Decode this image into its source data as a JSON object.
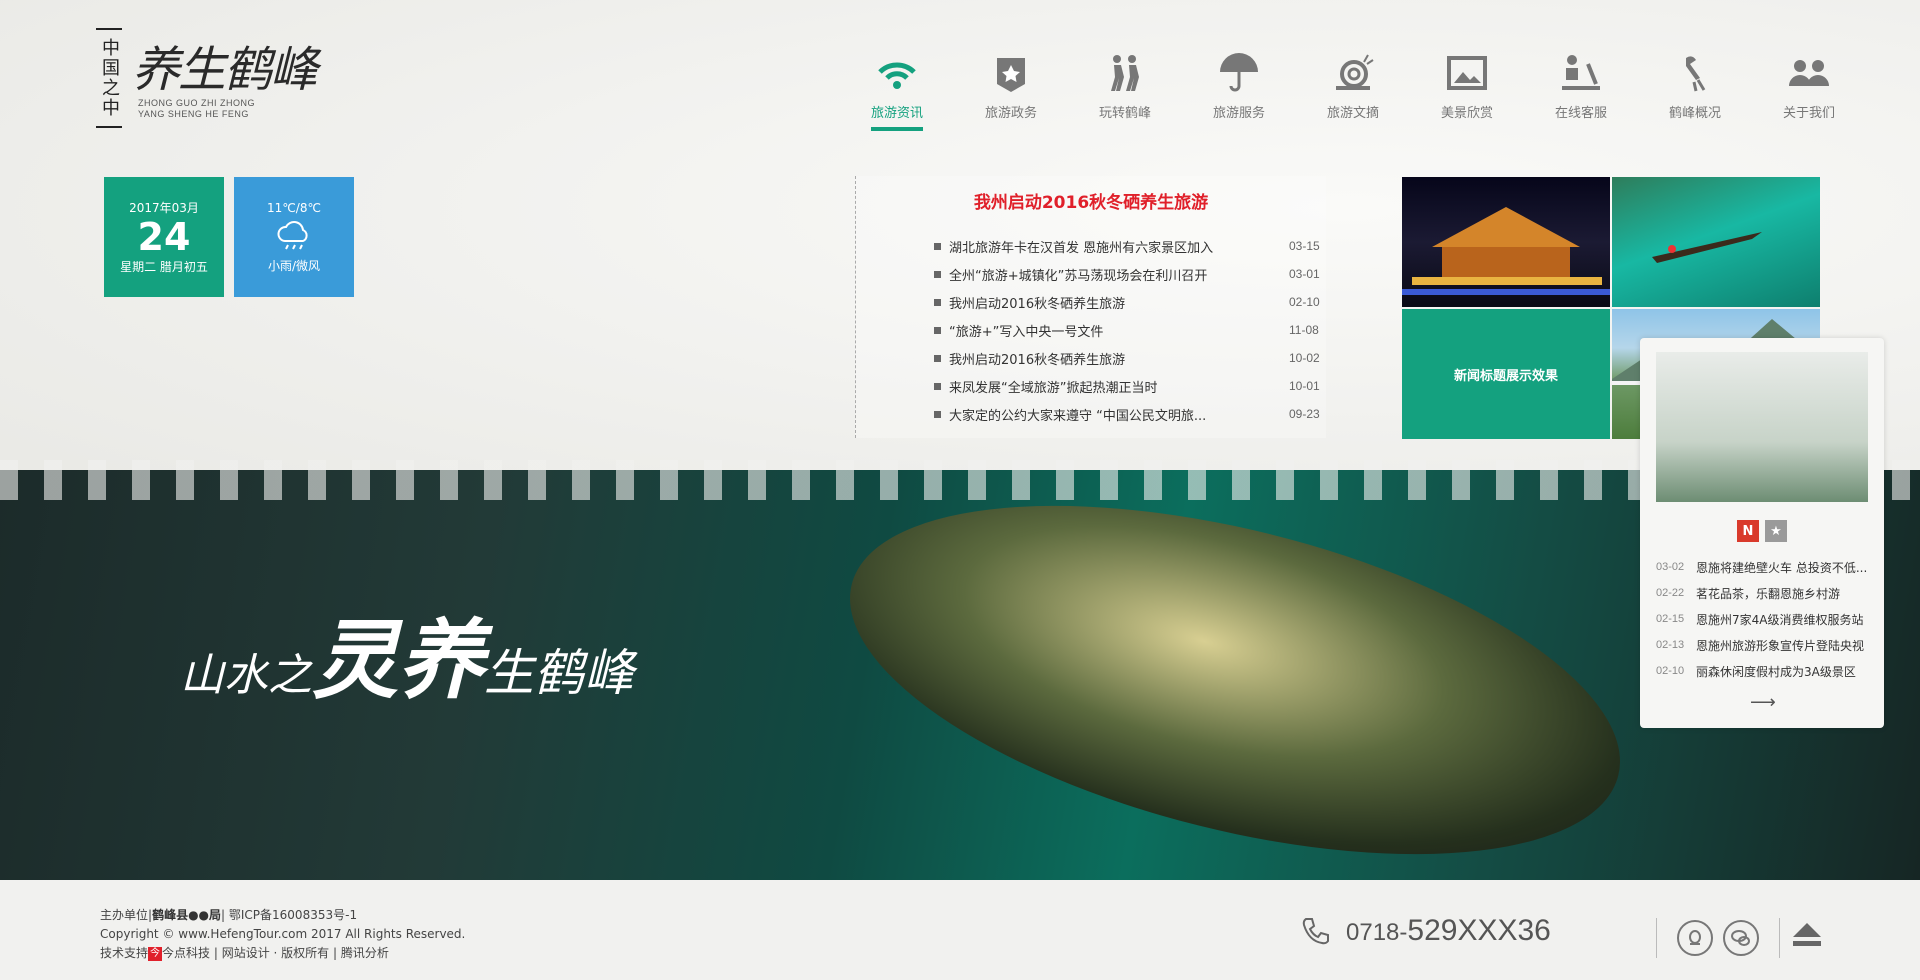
{
  "logo": {
    "vertical_text": "中国之中",
    "brush_text": "养生鹤峰",
    "pinyin_line1": "ZHONG GUO ZHI ZHONG",
    "pinyin_line2": "YANG SHENG HE FENG"
  },
  "nav": {
    "items": [
      {
        "label": "旅游资讯",
        "icon": "wifi-icon",
        "active": true
      },
      {
        "label": "旅游政务",
        "icon": "star-badge-icon"
      },
      {
        "label": "玩转鹤峰",
        "icon": "people-walking-icon"
      },
      {
        "label": "旅游服务",
        "icon": "umbrella-icon"
      },
      {
        "label": "旅游文摘",
        "icon": "snail-icon"
      },
      {
        "label": "美景欣赏",
        "icon": "picture-frame-icon"
      },
      {
        "label": "在线客服",
        "icon": "person-desk-icon"
      },
      {
        "label": "鹤峰概况",
        "icon": "crane-icon"
      },
      {
        "label": "关于我们",
        "icon": "group-icon"
      }
    ]
  },
  "date": {
    "year_month": "2017年03月",
    "day": "24",
    "weekday_lunar": "星期二 腊月初五"
  },
  "weather": {
    "temperature": "11℃/8℃",
    "condition": "小雨/微风",
    "icon": "cloud-rain-icon"
  },
  "news": {
    "headline": "我州启动2016秋冬硒养生旅游",
    "items": [
      {
        "title": "湖北旅游年卡在汉首发 恩施州有六家景区加入",
        "date": "03-15"
      },
      {
        "title": "全州“旅游+城镇化”苏马荡现场会在利川召开",
        "date": "03-01"
      },
      {
        "title": "我州启动2016秋冬硒养生旅游",
        "date": "02-10"
      },
      {
        "title": "“旅游+”写入中央一号文件",
        "date": "11-08"
      },
      {
        "title": "我州启动2016秋冬硒养生旅游",
        "date": "10-02"
      },
      {
        "title": "来凤发展“全域旅游”掀起热潮正当时",
        "date": "10-01"
      },
      {
        "title": "大家定的公约大家来遵守 “中国公民文明旅...",
        "date": "09-23"
      }
    ]
  },
  "photo_grid": {
    "caption": "新闻标题展示效果"
  },
  "banner": {
    "slogan_1": "山水之",
    "slogan_2": "灵养",
    "slogan_3": "生鹤峰"
  },
  "notice_card": {
    "tab_n": "N",
    "tab_star": "★",
    "items": [
      {
        "date": "03-02",
        "title": "恩施将建绝壁火车 总投资不低..."
      },
      {
        "date": "02-22",
        "title": "茗花品茶，乐翻恩施乡村游"
      },
      {
        "date": "02-15",
        "title": "恩施州7家4A级消费维权服务站"
      },
      {
        "date": "02-13",
        "title": "恩施州旅游形象宣传片登陆央视"
      },
      {
        "date": "02-10",
        "title": "丽森休闲度假村成为3A级景区"
      }
    ],
    "more": "⟶"
  },
  "footer": {
    "sponsor_label": "主办单位",
    "sponsor": "鹤峰县●●局",
    "icp": "鄂ICP备16008353号-1",
    "copyright": "Copyright © www.HefengTour.com 2017 All Rights Reserved.",
    "support_label": "技术支持",
    "support_tag": "今",
    "support_company": "今点科技",
    "support_rest": "| 网站设计 · 版权所有 | 腾讯分析"
  },
  "contact": {
    "phone_prefix": "0718-",
    "phone_number": "529XXX36"
  },
  "colors": {
    "accent": "#14a17f",
    "headline_red": "#e0202a",
    "weather_blue": "#3a9bd9"
  }
}
